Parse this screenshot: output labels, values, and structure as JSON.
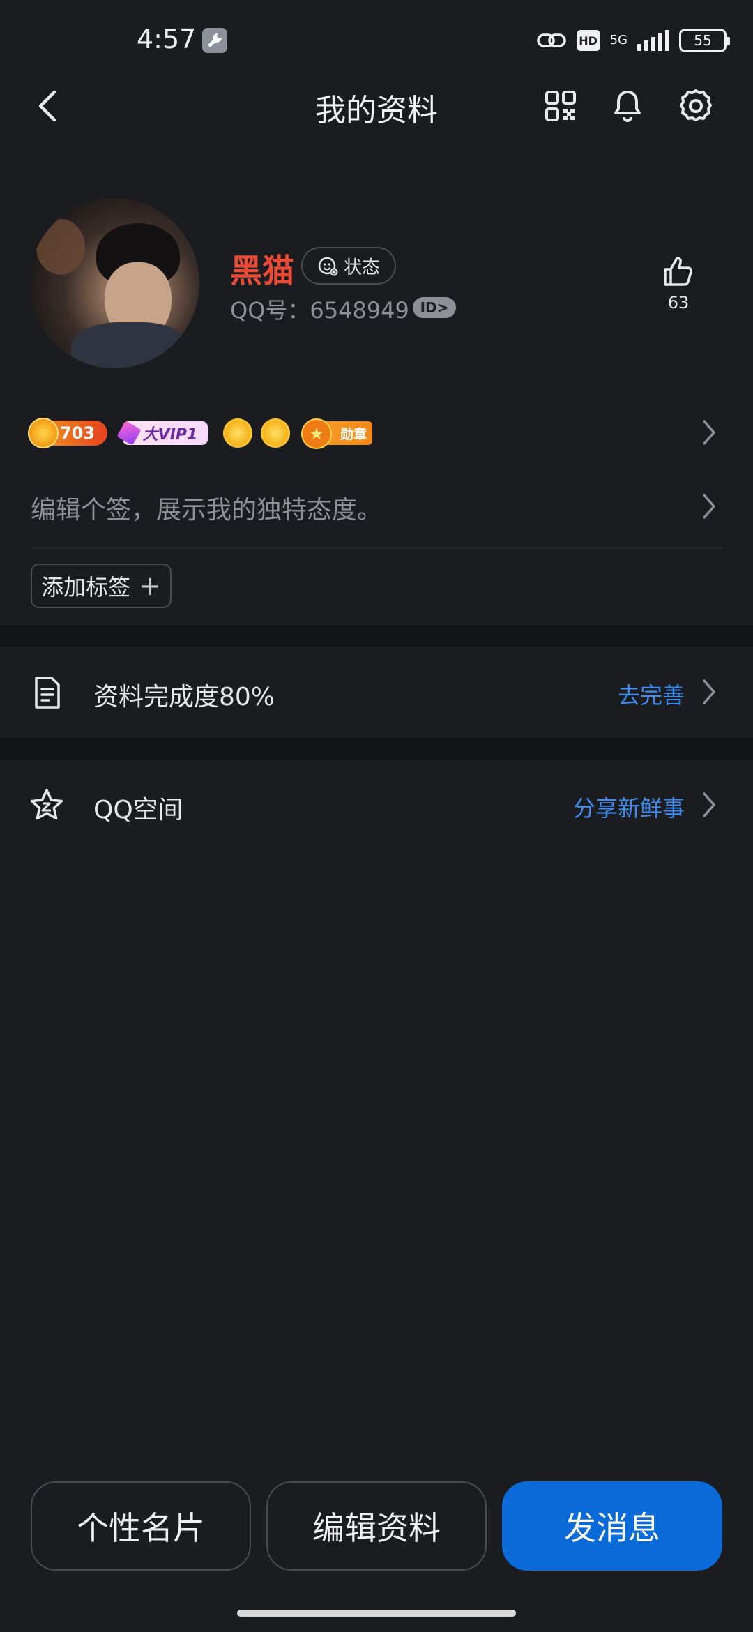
{
  "status_bar": {
    "time": "4:57",
    "hd": "HD",
    "network": "5G",
    "battery": "55"
  },
  "header": {
    "title": "我的资料"
  },
  "profile": {
    "nickname": "黑猫",
    "status_label": "状态",
    "qq_number_text": "QQ号：6548949",
    "id_badge": "ID>",
    "like_count": "63"
  },
  "badges": {
    "level": "703",
    "vip": "大VIP1",
    "medal": "勋章"
  },
  "signature": {
    "placeholder": "编辑个签，展示我的独特态度。"
  },
  "tags": {
    "add_label": "添加标签",
    "add_plus": "+"
  },
  "rows": [
    {
      "label": "资料完成度80%",
      "action": "去完善"
    },
    {
      "label": "QQ空间",
      "action": "分享新鲜事"
    }
  ],
  "bottom": {
    "card": "个性名片",
    "edit": "编辑资料",
    "message": "发消息"
  },
  "colors": {
    "background": "#1b1c1f",
    "nickname": "#ea4b36",
    "link": "#3f8cf0",
    "primary": "#0a6bd8"
  }
}
